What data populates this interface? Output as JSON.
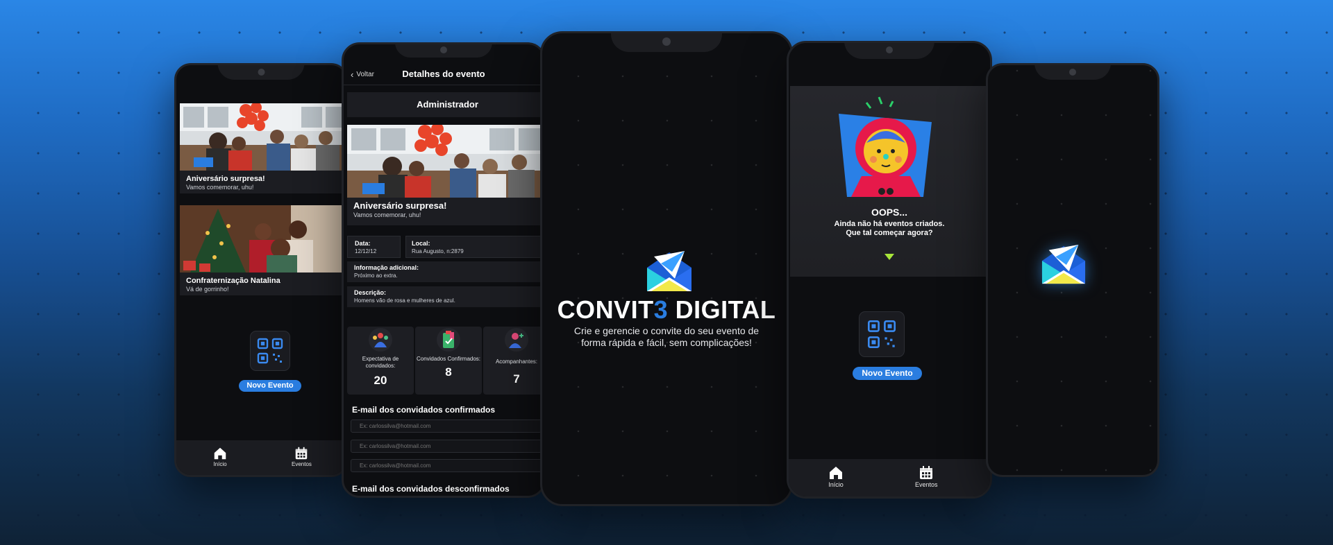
{
  "feed_screen": {
    "events": [
      {
        "title": "Aniversário surpresa!",
        "subtitle": "Vamos comemorar, uhu!"
      },
      {
        "title": "Confraternização Natalina",
        "subtitle": "Vá de gorrinho!"
      }
    ],
    "new_event_label": "Novo Evento",
    "tabs": [
      {
        "label": "Início",
        "icon": "home-icon"
      },
      {
        "label": "Eventos",
        "icon": "calendar-icon"
      }
    ]
  },
  "details_screen": {
    "back_label": "Voltar",
    "title": "Detalhes do evento",
    "role": "Administrador",
    "event_title": "Aniversário surpresa!",
    "event_subtitle": "Vamos comemorar, uhu!",
    "date_label": "Data:",
    "date_value": "12/12/12",
    "place_label": "Local:",
    "place_value": "Rua Augusto, n:2879",
    "info_label": "Informação adicional:",
    "info_value": "Próximo ao extra.",
    "desc_label": "Descrição:",
    "desc_value": "Homens vão de rosa e mulheres de azul.",
    "stats": [
      {
        "label": "Expectativa de convidados:",
        "value": "20"
      },
      {
        "label": "Convidados Confirmados:",
        "value": "8"
      },
      {
        "label": "Acompanhantes:",
        "value": "7"
      }
    ],
    "confirmed_heading": "E-mail dos convidados confirmados",
    "email_placeholder": "Ex: carlossilva@hotmail.com",
    "unconfirmed_heading": "E-mail dos convidados desconfirmados"
  },
  "splash_screen": {
    "brand_part1": "CONVIT",
    "brand_part2": "3",
    "brand_part3": " DIGITAL",
    "tagline_line1": "Crie e gerencie o convite do seu evento de",
    "tagline_line2": "forma rápida e fácil, sem complicações!"
  },
  "empty_screen": {
    "oops": "OOPS...",
    "message_line1": "Ainda não há eventos criados.",
    "message_line2": "Que tal começar agora?",
    "new_event_label": "Novo Evento",
    "tabs": [
      {
        "label": "Início",
        "icon": "home-icon"
      },
      {
        "label": "Eventos",
        "icon": "calendar-icon"
      }
    ]
  },
  "colors": {
    "accent": "#2a7de0",
    "background_top": "#2a86e6",
    "background_bottom": "#0f2236",
    "screen": "#0d0e11"
  }
}
